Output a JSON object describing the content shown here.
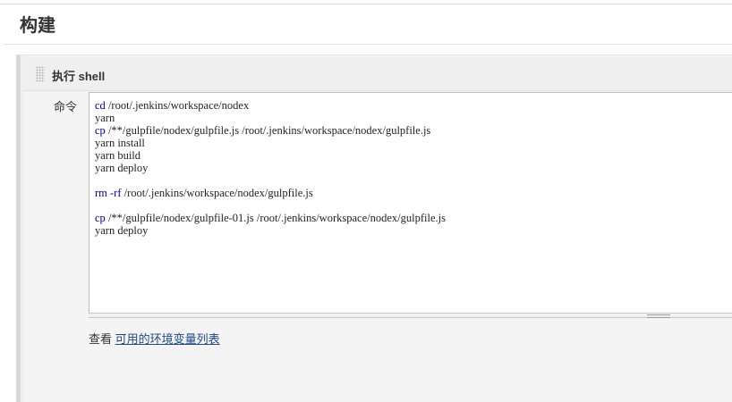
{
  "section": {
    "title": "构建"
  },
  "step": {
    "title": "执行 shell",
    "command_label": "命令",
    "command_lines": [
      [
        {
          "t": "cd",
          "kw": true
        },
        {
          "t": " /root/.jenkins/workspace/nodex"
        }
      ],
      [
        {
          "t": "yarn"
        }
      ],
      [
        {
          "t": "cp",
          "kw": true
        },
        {
          "t": " /**/gulpfile/nodex/gulpfile.js /root/.jenkins/workspace/nodex/gulpfile.js"
        }
      ],
      [
        {
          "t": "yarn install"
        }
      ],
      [
        {
          "t": "yarn build"
        }
      ],
      [
        {
          "t": "yarn deploy"
        }
      ],
      [],
      [
        {
          "t": "rm",
          "kw": true
        },
        {
          "t": " "
        },
        {
          "t": "-rf",
          "kw": true
        },
        {
          "t": " /root/.jenkins/workspace/nodex/gulpfile.js"
        }
      ],
      [],
      [
        {
          "t": "cp",
          "kw": true
        },
        {
          "t": " /**/gulpfile/nodex/gulpfile-01.js /root/.jenkins/workspace/nodex/gulpfile.js"
        }
      ],
      [
        {
          "t": "yarn deploy"
        }
      ]
    ]
  },
  "help": {
    "prefix": "查看 ",
    "link_text": "可用的环境变量列表"
  }
}
